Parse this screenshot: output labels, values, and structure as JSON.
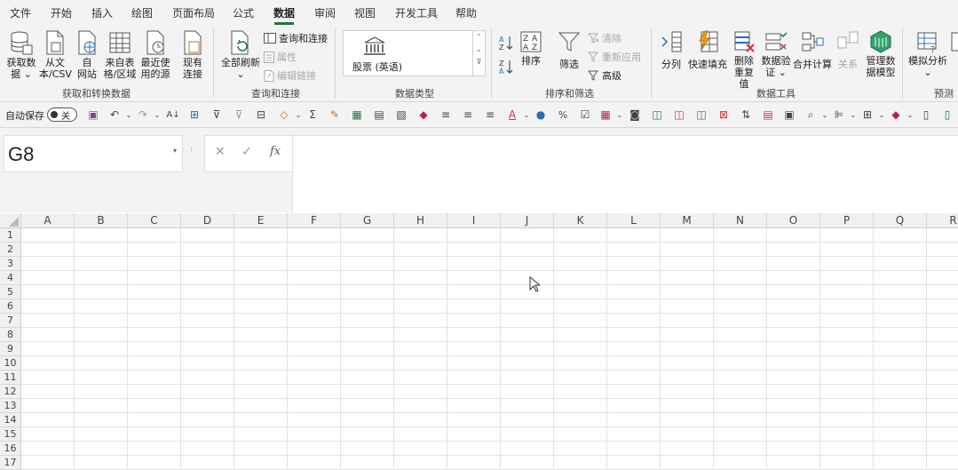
{
  "tabs": [
    "文件",
    "开始",
    "插入",
    "绘图",
    "页面布局",
    "公式",
    "数据",
    "审阅",
    "视图",
    "开发工具",
    "帮助"
  ],
  "active_tab": "数据",
  "ribbon": {
    "get_data": {
      "l1": "获取数",
      "l2": "据 ⌄"
    },
    "from_text": {
      "l1": "从文",
      "l2": "本/CSV"
    },
    "from_web": {
      "l1": "自",
      "l2": "网站"
    },
    "from_table": {
      "l1": "来自表",
      "l2": "格/区域"
    },
    "recent_sources": {
      "l1": "最近使",
      "l2": "用的源"
    },
    "existing_conn": {
      "l1": "现有",
      "l2": "连接"
    },
    "group1_label": "获取和转换数据",
    "refresh_all": {
      "l1": "全部刷新",
      "l2": "⌄"
    },
    "queries_conn": "查询和连接",
    "properties": "属性",
    "edit_links": "编辑链接",
    "group2_label": "查询和连接",
    "stocks": "股票 (英语)",
    "group3_label": "数据类型",
    "sort": "排序",
    "filter": "筛选",
    "clear": "清除",
    "reapply": "重新应用",
    "advanced": "高级",
    "group4_label": "排序和筛选",
    "text_to_columns": "分列",
    "flash_fill": "快速填充",
    "remove_dup": {
      "l1": "删除",
      "l2": "重复值"
    },
    "data_validation": {
      "l1": "数据验",
      "l2": "证 ⌄"
    },
    "consolidate": "合并计算",
    "relationships": "关系",
    "manage_model": {
      "l1": "管理数",
      "l2": "据模型"
    },
    "group5_label": "数据工具",
    "what_if": {
      "l1": "模拟分析",
      "l2": "⌄"
    },
    "group6_label": "预测"
  },
  "qat": {
    "autosave_label": "自动保存",
    "autosave_state": "关"
  },
  "formula_bar": {
    "name_box": "G8",
    "cancel": "✕",
    "enter": "✓",
    "fx": "fx",
    "formula": ""
  },
  "columns": [
    "A",
    "B",
    "C",
    "D",
    "E",
    "F",
    "G",
    "H",
    "I",
    "J",
    "K",
    "L",
    "M",
    "N",
    "O",
    "P",
    "Q",
    "R"
  ],
  "rows": [
    "1",
    "2",
    "3",
    "4",
    "5",
    "6",
    "7",
    "8",
    "9",
    "10",
    "11",
    "12",
    "13",
    "14",
    "15",
    "16",
    "17"
  ],
  "colors": {
    "accent": "#217346",
    "ribbon_bg": "#f3f3f3"
  }
}
